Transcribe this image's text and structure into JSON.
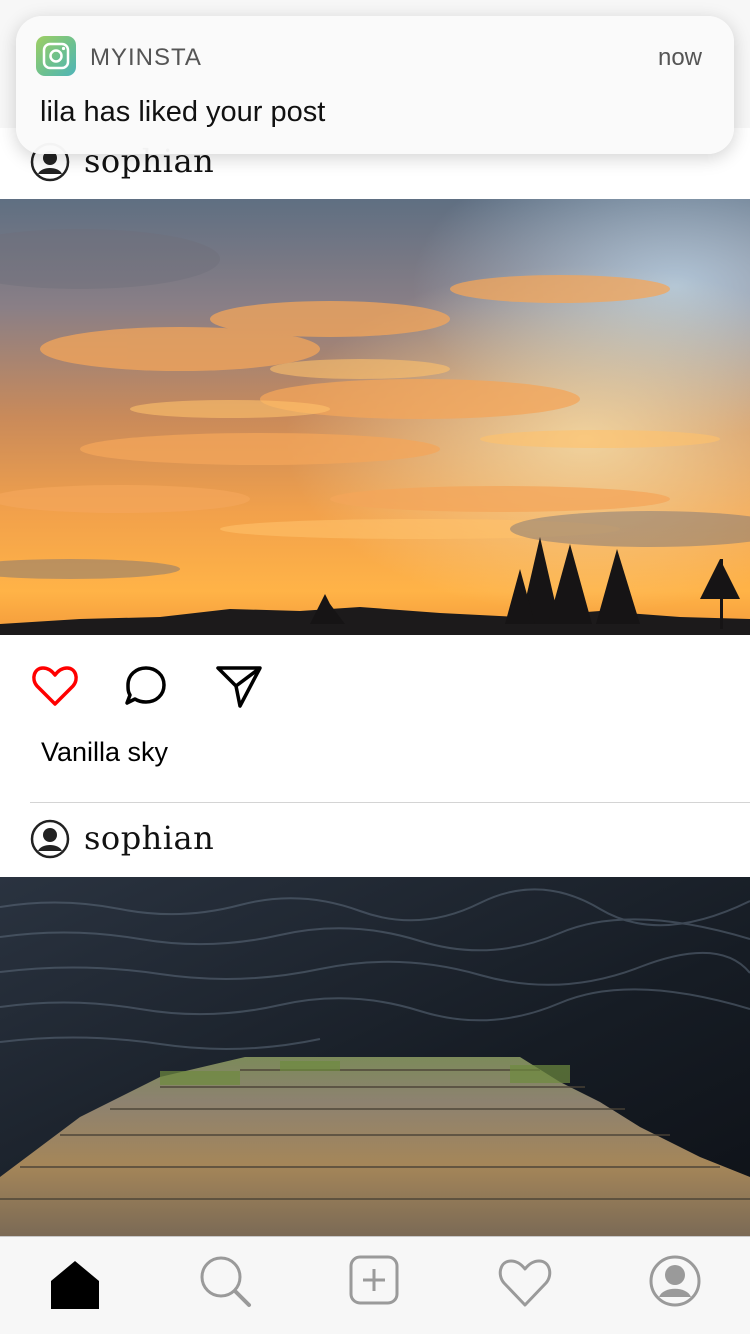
{
  "notification": {
    "app_name": "MYINSTA",
    "time": "now",
    "message": "lila has liked your post",
    "icon": "camera-icon"
  },
  "feed": {
    "posts": [
      {
        "username": "sophian",
        "image": "sunset-sky-photo",
        "liked": true,
        "caption": "Vanilla sky"
      },
      {
        "username": "sophian",
        "image": "stone-steps-water-photo"
      }
    ]
  },
  "tabbar": {
    "items": [
      {
        "icon": "home-icon",
        "active": true
      },
      {
        "icon": "search-icon"
      },
      {
        "icon": "add-post-icon"
      },
      {
        "icon": "heart-icon"
      },
      {
        "icon": "profile-icon"
      }
    ]
  },
  "colors": {
    "like_red": "#ff0000",
    "icon_gray": "#9a9a9a",
    "tabbar_bg": "#f7f7f7"
  }
}
